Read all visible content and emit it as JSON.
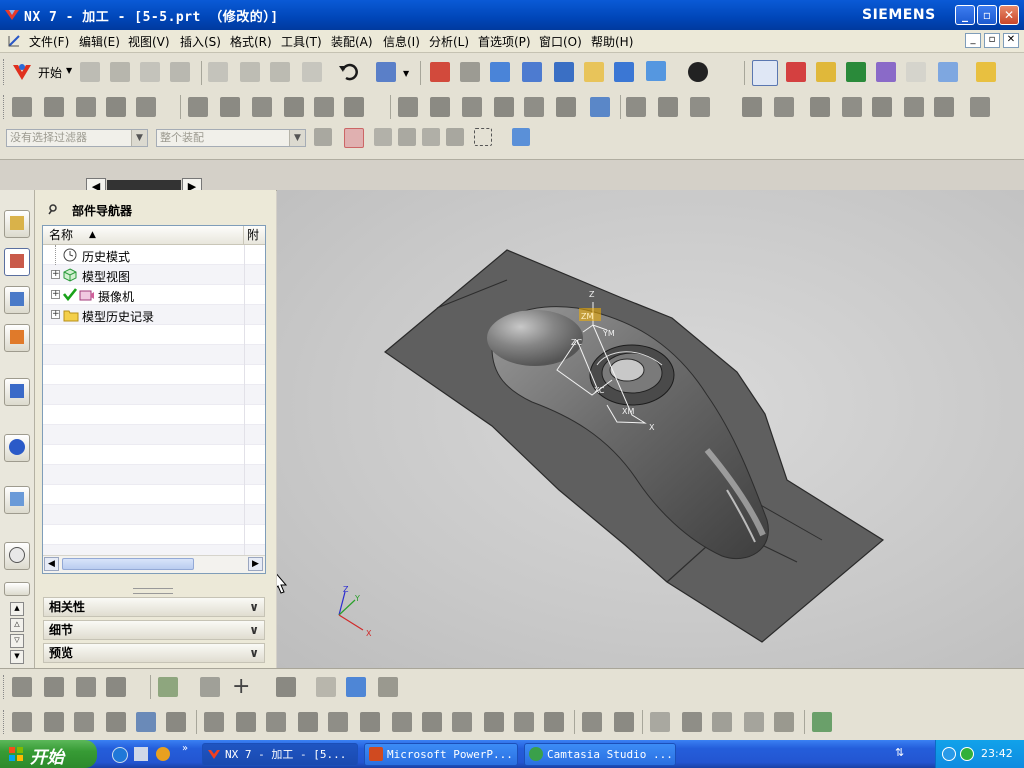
{
  "window": {
    "title": "NX 7 - 加工 - [5-5.prt （修改的）]",
    "brand": "SIEMENS"
  },
  "menu": {
    "items": [
      "文件(F)",
      "编辑(E)",
      "视图(V)",
      "插入(S)",
      "格式(R)",
      "工具(T)",
      "装配(A)",
      "信息(I)",
      "分析(L)",
      "首选项(P)",
      "窗口(O)",
      "帮助(H)"
    ]
  },
  "toolbar": {
    "start_label": "开始",
    "selection_filter": "没有选择过滤器",
    "assembly_scope": "整个装配"
  },
  "part_navigator": {
    "title": "部件导航器",
    "columns": [
      "名称",
      "附"
    ],
    "items": [
      {
        "label": "历史模式",
        "icon": "clock-icon"
      },
      {
        "label": "模型视图",
        "icon": "cube-view-icon"
      },
      {
        "label": "摄像机",
        "icon": "camera-icon"
      },
      {
        "label": "模型历史记录",
        "icon": "folder-icon"
      }
    ],
    "panels": [
      "相关性",
      "细节",
      "预览"
    ]
  },
  "viewport": {
    "axis_labels": {
      "z": "Z",
      "y": "Y",
      "x": "X"
    },
    "csys_labels": {
      "zm": "ZM",
      "zc": "ZC",
      "ym": "YM",
      "xc": "XC",
      "xm": "XM",
      "x": "X",
      "z": "Z"
    }
  },
  "taskbar": {
    "start_label": "开始",
    "tasks": [
      "NX 7 - 加工 - [5...",
      "Microsoft PowerP...",
      "Camtasia Studio ..."
    ],
    "clock": "23:42"
  },
  "colors": {
    "titlebar": "#0046b8",
    "taskbar": "#245edb",
    "start_button": "#379b35",
    "viewport": "#c9c9c9",
    "model": "#6a6a6a"
  }
}
